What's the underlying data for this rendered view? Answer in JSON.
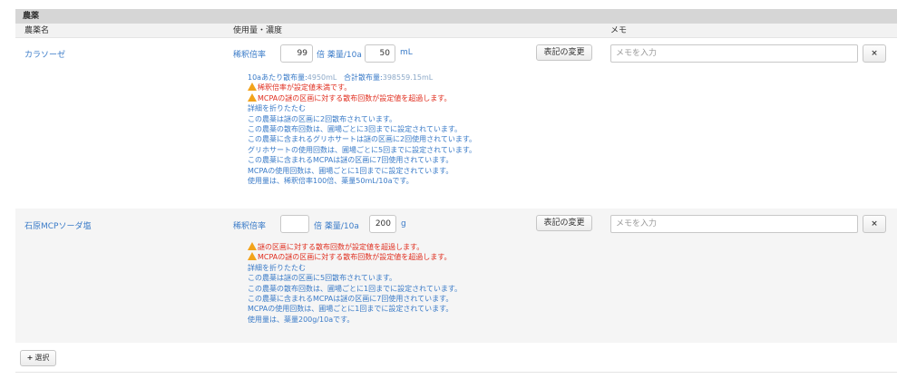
{
  "section": {
    "title": "農薬"
  },
  "columns": {
    "name": "農薬名",
    "usage": "使用量・濃度",
    "memo": "メモ"
  },
  "rows": [
    {
      "name": "カラソーゼ",
      "dilution_label": "稀釈倍率",
      "dilution_value": "99",
      "dilution_unit": "倍 薬量/10a",
      "amount_value": "50",
      "amount_unit": "mL",
      "change_label": "表記の変更",
      "memo_placeholder": "メモを入力",
      "delete_label": "×",
      "summary": {
        "per10a_label": "10aあたり散布量:",
        "per10a_value": "4950mL",
        "total_label": "合計散布量:",
        "total_value": "398559.15mL"
      },
      "warnings": [
        "稀釈倍率が設定値未満です。",
        "MCPAの謎の区画に対する散布回数が設定値を超過します。"
      ],
      "collapse_label": "詳細を折りたたむ",
      "details": [
        "この農薬は謎の区画に2回散布されています。",
        "この農薬の散布回数は、圃場ごとに3回までに設定されています。",
        "この農薬に含まれるグリホサートは謎の区画に2回使用されています。",
        "グリホサートの使用回数は、圃場ごとに5回までに設定されています。",
        "この農薬に含まれるMCPAは謎の区画に7回使用されています。",
        "MCPAの使用回数は、圃場ごとに1回までに設定されています。",
        "使用量は、稀釈倍率100倍、薬量50mL/10aです。"
      ]
    },
    {
      "name": "石原MCPソーダ塩",
      "dilution_label": "稀釈倍率",
      "dilution_value": "",
      "dilution_unit": "倍 薬量/10a",
      "amount_value": "200",
      "amount_unit": "g",
      "change_label": "表記の変更",
      "memo_placeholder": "メモを入力",
      "delete_label": "×",
      "warnings": [
        "謎の区画に対する散布回数が設定値を超過します。",
        "MCPAの謎の区画に対する散布回数が設定値を超過します。"
      ],
      "collapse_label": "詳細を折りたたむ",
      "details": [
        "この農薬は謎の区画に5回散布されています。",
        "この農薬の散布回数は、圃場ごとに1回までに設定されています。",
        "この農薬に含まれるMCPAは謎の区画に7回使用されています。",
        "MCPAの使用回数は、圃場ごとに1回までに設定されています。",
        "使用量は、薬量200g/10aです。"
      ]
    }
  ],
  "add_button": {
    "label": "選択",
    "icon": "plus-icon"
  },
  "colors": {
    "link": "#3a7bc8",
    "warning": "#e02e1f",
    "warning_icon": "#f2a31b",
    "header_bg": "#d6d6d6"
  }
}
